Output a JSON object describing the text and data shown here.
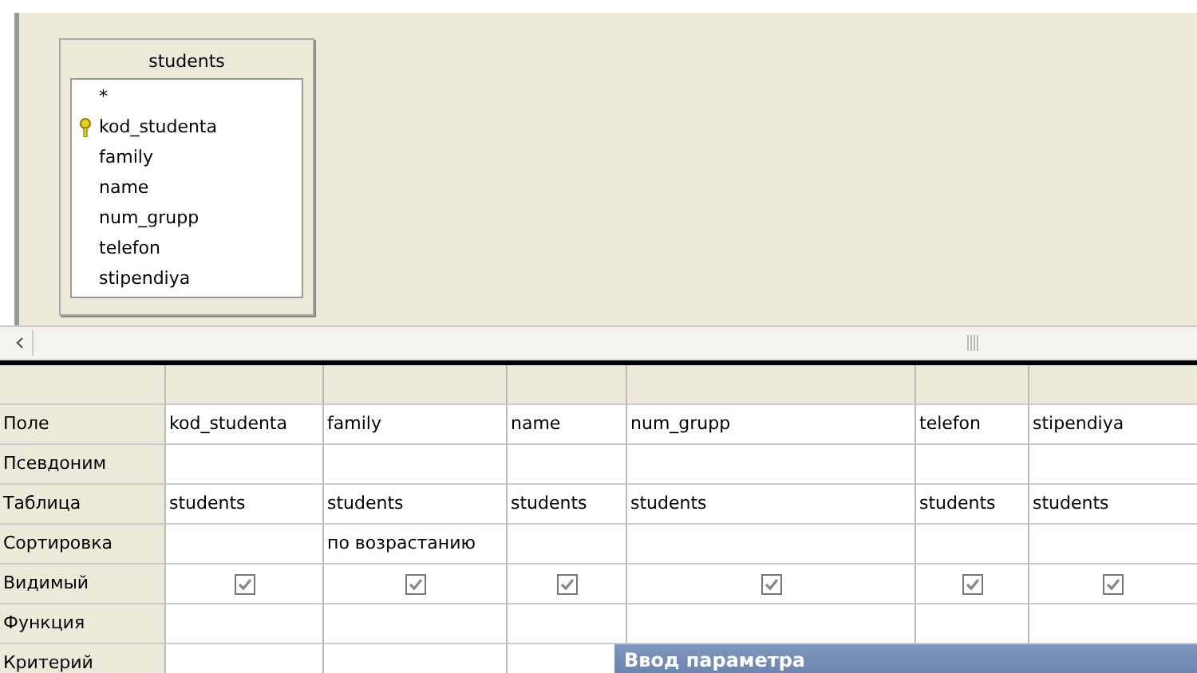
{
  "table_box": {
    "title": "students",
    "fields": [
      {
        "name": "*",
        "key": false
      },
      {
        "name": "kod_studenta",
        "key": true
      },
      {
        "name": "family",
        "key": false
      },
      {
        "name": "name",
        "key": false
      },
      {
        "name": "num_grupp",
        "key": false
      },
      {
        "name": "telefon",
        "key": false
      },
      {
        "name": "stipendiya",
        "key": false
      }
    ]
  },
  "grid": {
    "row_labels": [
      "Поле",
      "Псевдоним",
      "Таблица",
      "Сортировка",
      "Видимый",
      "Функция",
      "Критерий"
    ],
    "columns": [
      {
        "field": "kod_studenta",
        "table": "students",
        "visible": true
      },
      {
        "field": "family",
        "table": "students",
        "sort": "по возрастанию",
        "visible": true
      },
      {
        "field": "name",
        "table": "students",
        "visible": true
      },
      {
        "field": "num_grupp",
        "table": "students",
        "visible": true
      },
      {
        "field": "telefon",
        "table": "students",
        "visible": true
      },
      {
        "field": "stipendiya",
        "table": "students",
        "visible": true
      }
    ]
  },
  "dialog": {
    "title": "Ввод параметра"
  }
}
